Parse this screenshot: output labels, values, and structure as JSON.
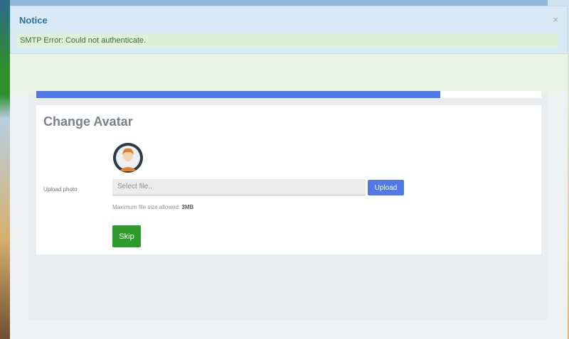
{
  "notice": {
    "title": "Notice",
    "close": "×",
    "message": "SMTP Error: Could not authenticate."
  },
  "progress": {
    "value_percent": 80
  },
  "avatar_section": {
    "title": "Change Avatar",
    "avatar_icon": "user-avatar-icon",
    "upload_label": "Upload photo",
    "file_placeholder": "Select file..",
    "upload_button": "Upload",
    "max_size_text": "Maximum file size allowed:",
    "max_size_value": "3MB",
    "skip_button": "Skip"
  },
  "colors": {
    "primary": "#4f78e8",
    "success": "#2f9a2c",
    "notice_title": "#2b6fa3",
    "notice_bg": "#d9eaf6",
    "alert_bg": "#dff0d8"
  }
}
